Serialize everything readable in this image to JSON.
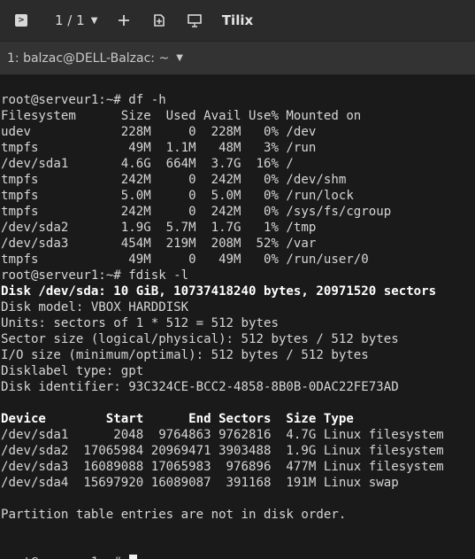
{
  "titlebar": {
    "app_icon": "terminal-icon",
    "session_count": "1 / 1",
    "title": "Tilix",
    "icons": [
      "chevron-down-icon",
      "add-icon",
      "detach-icon",
      "resize-icon"
    ]
  },
  "session": {
    "label": "1: balzac@DELL-Balzac: ~"
  },
  "terminal": {
    "lines": [
      {
        "text": "root@serveur1:~# df -h",
        "bold": false
      },
      {
        "text": "Filesystem      Size  Used Avail Use% Mounted on",
        "bold": false
      },
      {
        "text": "udev            228M     0  228M   0% /dev",
        "bold": false
      },
      {
        "text": "tmpfs            49M  1.1M   48M   3% /run",
        "bold": false
      },
      {
        "text": "/dev/sda1       4.6G  664M  3.7G  16% /",
        "bold": false
      },
      {
        "text": "tmpfs           242M     0  242M   0% /dev/shm",
        "bold": false
      },
      {
        "text": "tmpfs           5.0M     0  5.0M   0% /run/lock",
        "bold": false
      },
      {
        "text": "tmpfs           242M     0  242M   0% /sys/fs/cgroup",
        "bold": false
      },
      {
        "text": "/dev/sda2       1.9G  5.7M  1.7G   1% /tmp",
        "bold": false
      },
      {
        "text": "/dev/sda3       454M  219M  208M  52% /var",
        "bold": false
      },
      {
        "text": "tmpfs            49M     0   49M   0% /run/user/0",
        "bold": false
      },
      {
        "text": "root@serveur1:~# fdisk -l",
        "bold": false
      },
      {
        "text": "Disk /dev/sda: 10 GiB, 10737418240 bytes, 20971520 sectors",
        "bold": true
      },
      {
        "text": "Disk model: VBOX HARDDISK",
        "bold": false
      },
      {
        "text": "Units: sectors of 1 * 512 = 512 bytes",
        "bold": false
      },
      {
        "text": "Sector size (logical/physical): 512 bytes / 512 bytes",
        "bold": false
      },
      {
        "text": "I/O size (minimum/optimal): 512 bytes / 512 bytes",
        "bold": false
      },
      {
        "text": "Disklabel type: gpt",
        "bold": false
      },
      {
        "text": "Disk identifier: 93C324CE-BCC2-4858-8B0B-0DAC22FE73AD",
        "bold": false
      },
      {
        "text": "",
        "bold": false
      },
      {
        "text": "Device        Start      End Sectors  Size Type",
        "bold": true
      },
      {
        "text": "/dev/sda1      2048  9764863 9762816  4.7G Linux filesystem",
        "bold": false
      },
      {
        "text": "/dev/sda2  17065984 20969471 3903488  1.9G Linux filesystem",
        "bold": false
      },
      {
        "text": "/dev/sda3  16089088 17065983  976896  477M Linux filesystem",
        "bold": false
      },
      {
        "text": "/dev/sda4  15697920 16089087  391168  191M Linux swap",
        "bold": false
      },
      {
        "text": "",
        "bold": false
      },
      {
        "text": "Partition table entries are not in disk order.",
        "bold": false
      },
      {
        "text": "",
        "bold": false
      },
      {
        "text": "",
        "bold": false
      }
    ],
    "prompt": "root@serveur1:~# "
  }
}
